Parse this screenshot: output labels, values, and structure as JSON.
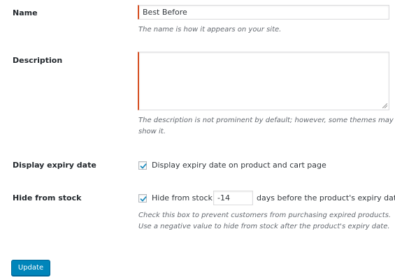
{
  "fields": {
    "name": {
      "label": "Name",
      "value": "Best Before",
      "help": "The name is how it appears on your site."
    },
    "description": {
      "label": "Description",
      "value": "",
      "help": "The description is not prominent by default; however, some themes may show it."
    },
    "display_expiry": {
      "label": "Display expiry date",
      "checked": true,
      "checkbox_label": "Display expiry date on product and cart page"
    },
    "hide_from_stock": {
      "label": "Hide from stock",
      "checked": true,
      "checkbox_label": "Hide from stock",
      "days_value": "-14",
      "days_suffix": "days before the product's expiry date",
      "help_line1": "Check this box to prevent customers from purchasing expired products.",
      "help_line2": "Use a negative value to hide from stock after the product's expiry date."
    }
  },
  "actions": {
    "update_label": "Update"
  },
  "colors": {
    "accent_border": "#d54e21",
    "button": "#0085ba",
    "checkmark": "#1e8cbe"
  }
}
